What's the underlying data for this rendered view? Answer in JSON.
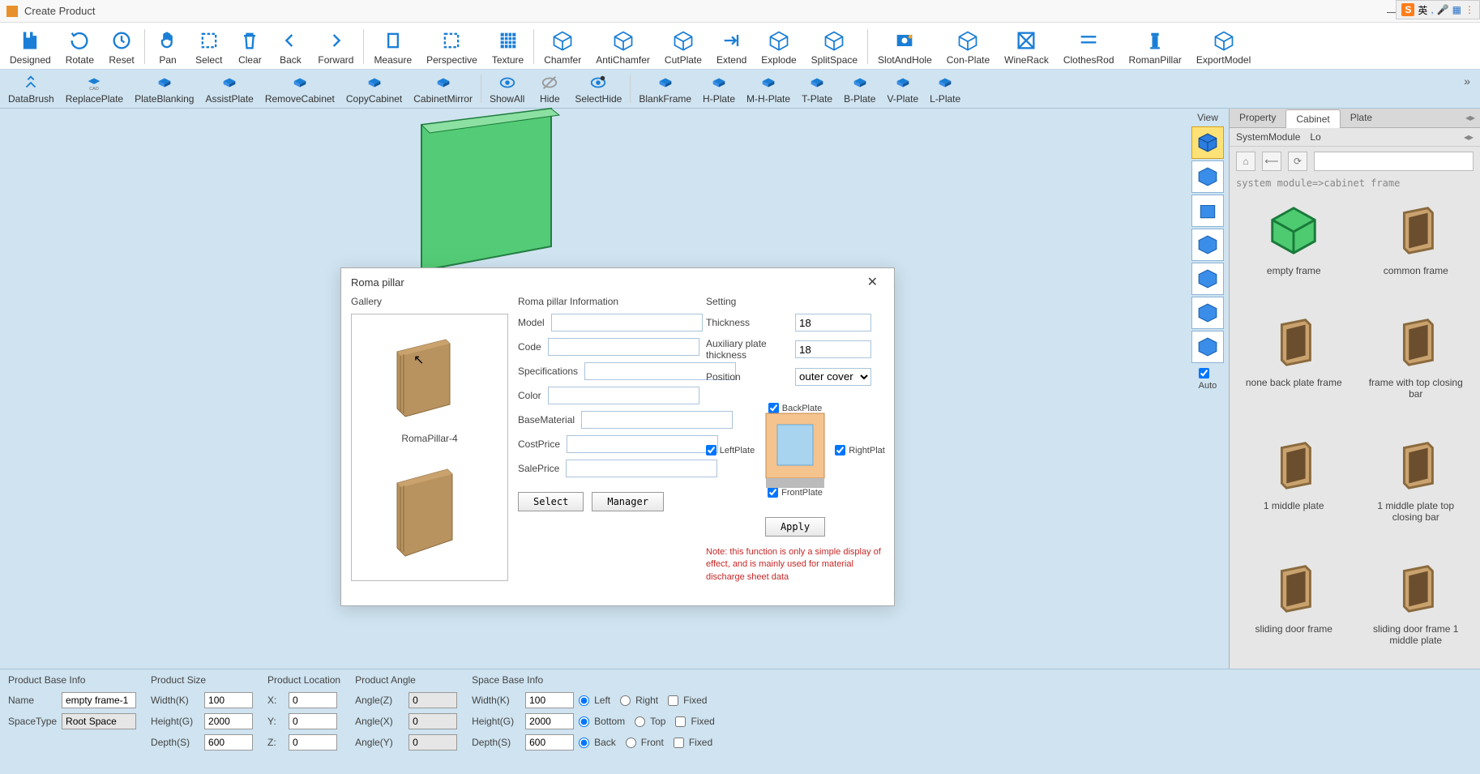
{
  "app": {
    "title": "Create Product"
  },
  "window_buttons": {
    "min": "—",
    "max": "▢",
    "close": "✕"
  },
  "ribbon": [
    {
      "id": "designed",
      "label": "Designed"
    },
    {
      "id": "rotate",
      "label": "Rotate"
    },
    {
      "id": "reset",
      "label": "Reset"
    },
    {
      "sep": true
    },
    {
      "id": "pan",
      "label": "Pan"
    },
    {
      "id": "select",
      "label": "Select"
    },
    {
      "id": "clear",
      "label": "Clear"
    },
    {
      "id": "back",
      "label": "Back"
    },
    {
      "id": "forward",
      "label": "Forward"
    },
    {
      "sep": true
    },
    {
      "id": "measure",
      "label": "Measure"
    },
    {
      "id": "perspective",
      "label": "Perspective"
    },
    {
      "id": "texture",
      "label": "Texture"
    },
    {
      "sep": true
    },
    {
      "id": "chamfer",
      "label": "Chamfer"
    },
    {
      "id": "antichamfer",
      "label": "AntiChamfer"
    },
    {
      "id": "cutplate",
      "label": "CutPlate"
    },
    {
      "id": "extend",
      "label": "Extend"
    },
    {
      "id": "explode",
      "label": "Explode"
    },
    {
      "id": "splitspace",
      "label": "SplitSpace"
    },
    {
      "sep": true
    },
    {
      "id": "slotandhole",
      "label": "SlotAndHole"
    },
    {
      "id": "conplate",
      "label": "Con-Plate"
    },
    {
      "id": "winerack",
      "label": "WineRack"
    },
    {
      "id": "clothesrod",
      "label": "ClothesRod"
    },
    {
      "id": "romanpillar",
      "label": "RomanPillar"
    },
    {
      "id": "exportmodel",
      "label": "ExportModel"
    }
  ],
  "toolbar2": [
    {
      "id": "databrush",
      "label": "DataBrush"
    },
    {
      "id": "replaceplate",
      "label": "ReplacePlate"
    },
    {
      "id": "plateblanking",
      "label": "PlateBlanking"
    },
    {
      "id": "assistplate",
      "label": "AssistPlate"
    },
    {
      "id": "removecabinet",
      "label": "RemoveCabinet"
    },
    {
      "id": "copycabinet",
      "label": "CopyCabinet"
    },
    {
      "id": "cabinetmirror",
      "label": "CabinetMirror"
    },
    {
      "sep": true
    },
    {
      "id": "showall",
      "label": "ShowAll"
    },
    {
      "id": "hide",
      "label": "Hide"
    },
    {
      "id": "selecthide",
      "label": "SelectHide"
    },
    {
      "sep": true
    },
    {
      "id": "blankframe",
      "label": "BlankFrame"
    },
    {
      "id": "hplate",
      "label": "H-Plate"
    },
    {
      "id": "mhplate",
      "label": "M-H-Plate"
    },
    {
      "id": "tplate",
      "label": "T-Plate"
    },
    {
      "id": "bplate",
      "label": "B-Plate"
    },
    {
      "id": "vplate",
      "label": "V-Plate"
    },
    {
      "id": "lplate",
      "label": "L-Plate"
    }
  ],
  "viewstrip": {
    "title": "View",
    "auto_label": "Auto"
  },
  "sidepanel": {
    "tabs": [
      {
        "id": "property",
        "label": "Property"
      },
      {
        "id": "cabinet",
        "label": "Cabinet",
        "active": true
      },
      {
        "id": "plate",
        "label": "Plate"
      }
    ],
    "subtabs": [
      {
        "id": "systemmodule",
        "label": "SystemModule"
      },
      {
        "id": "loc",
        "label": "Lo"
      }
    ],
    "crumb": "system module=>cabinet frame",
    "items": [
      {
        "label": "empty frame",
        "green": true
      },
      {
        "label": "common frame"
      },
      {
        "label": "none back plate frame"
      },
      {
        "label": "frame with top closing bar"
      },
      {
        "label": "1 middle plate"
      },
      {
        "label": "1 middle plate top closing bar"
      },
      {
        "label": "sliding door frame"
      },
      {
        "label": "sliding door frame 1 middle plate"
      }
    ]
  },
  "ime": {
    "lang": "英",
    "symbols": [
      ",",
      "•)",
      "▦",
      "⋮"
    ]
  },
  "modal": {
    "title": "Roma pillar",
    "gallery_title": "Gallery",
    "gallery_items": [
      {
        "label": "RomaPillar-4"
      },
      {
        "label": ""
      }
    ],
    "info_title": "Roma pillar Information",
    "info_fields": {
      "model": {
        "label": "Model",
        "value": ""
      },
      "code": {
        "label": "Code",
        "value": ""
      },
      "spec": {
        "label": "Specifications",
        "value": ""
      },
      "color": {
        "label": "Color",
        "value": ""
      },
      "basematerial": {
        "label": "BaseMaterial",
        "value": ""
      },
      "costprice": {
        "label": "CostPrice",
        "value": ""
      },
      "saleprice": {
        "label": "SalePrice",
        "value": ""
      }
    },
    "setting_title": "Setting",
    "setting": {
      "thickness": {
        "label": "Thickness",
        "value": "18"
      },
      "aux": {
        "label": "Auxiliary plate thickness",
        "value": "18"
      },
      "position": {
        "label": "Position",
        "value": "outer cover"
      },
      "backplate": "BackPlate",
      "leftplate": "LeftPlate",
      "rightplate": "RightPlat",
      "frontplate": "FrontPlate"
    },
    "buttons": {
      "select": "Select",
      "manager": "Manager",
      "apply": "Apply"
    },
    "note": "Note: this function is only a simple display of effect, and is mainly used for material discharge sheet data"
  },
  "bottom": {
    "product_base_title": "Product Base Info",
    "name_label": "Name",
    "name_value": "empty frame-1",
    "spacetype_label": "SpaceType",
    "spacetype_value": "Root Space",
    "product_size_title": "Product Size",
    "width_label": "Width(K)",
    "width_value": "100",
    "height_label": "Height(G)",
    "height_value": "2000",
    "depth_label": "Depth(S)",
    "depth_value": "600",
    "product_loc_title": "Product Location",
    "x_label": "X:",
    "x_value": "0",
    "y_label": "Y:",
    "y_value": "0",
    "z_label": "Z:",
    "z_value": "0",
    "product_angle_title": "Product Angle",
    "anglez_label": "Angle(Z)",
    "anglez_value": "0",
    "anglex_label": "Angle(X)",
    "anglex_value": "0",
    "angley_label": "Angle(Y)",
    "angley_value": "0",
    "space_base_title": "Space Base Info",
    "sb_width_label": "Width(K)",
    "sb_width_value": "100",
    "sb_height_label": "Height(G)",
    "sb_height_value": "2000",
    "sb_depth_label": "Depth(S)",
    "sb_depth_value": "600",
    "left": "Left",
    "right": "Right",
    "bottom": "Bottom",
    "top": "Top",
    "back": "Back",
    "front": "Front",
    "fixed": "Fixed"
  }
}
